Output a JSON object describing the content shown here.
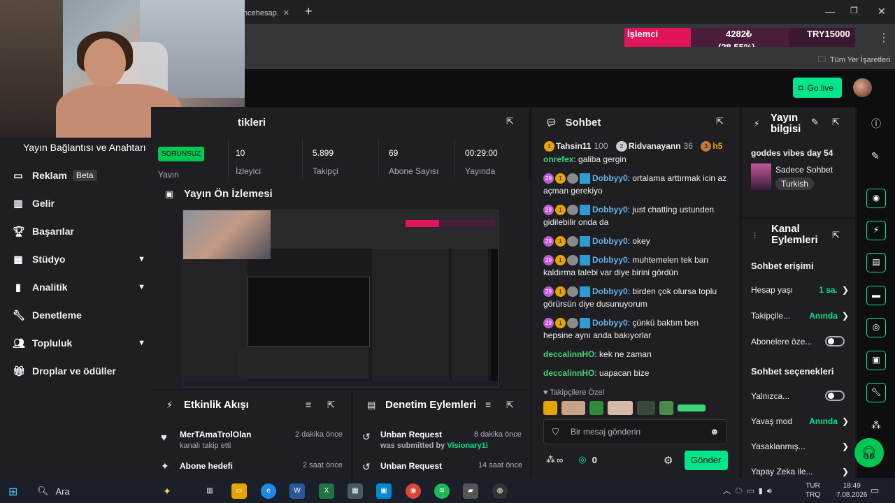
{
  "browser": {
    "tab_label": "ncehesap.",
    "bookmarks_all": "Tüm Yer İşaretleri"
  },
  "perf_overlay": {
    "label": "İşlemci",
    "value": "4282₺",
    "percent": "(28.55%)",
    "target": "TRY15000"
  },
  "topbar": {
    "go_live": "Go live"
  },
  "nav": {
    "title": "Yayın Bağlantısı ve Anahtarı",
    "items": [
      {
        "icon": "ads-icon",
        "label": "Reklam",
        "badge": "Beta"
      },
      {
        "icon": "income-icon",
        "label": "Gelir"
      },
      {
        "icon": "trophy-icon",
        "label": "Başarılar"
      },
      {
        "icon": "studio-icon",
        "label": "Stüdyo"
      },
      {
        "icon": "analytics-icon",
        "label": "Analitik"
      },
      {
        "icon": "wrench-icon",
        "label": "Denetleme"
      },
      {
        "icon": "community-icon",
        "label": "Topluluk"
      },
      {
        "icon": "drops-icon",
        "label": "Droplar ve ödüller"
      }
    ]
  },
  "stats": {
    "title": "tikleri",
    "status_badge": "SORUNSUZ",
    "status_label": "Yayın",
    "cols": [
      {
        "value": "10",
        "label": "İzleyici"
      },
      {
        "value": "5.899",
        "label": "Takipçi"
      },
      {
        "value": "69",
        "label": "Abone Sayısı"
      },
      {
        "value": "00:29:00",
        "label": "Yayında"
      }
    ]
  },
  "preview": {
    "title": "Yayın Ön İzlemesi"
  },
  "activity": {
    "title": "Etkinlik Akışı",
    "items": [
      {
        "name": "MerTAmaTrolOlan",
        "sub": "kanalı takip etti",
        "time": "2 dakika önce"
      },
      {
        "name": "Abone hedefi",
        "sub": "",
        "time": "2 saat önce"
      }
    ]
  },
  "moderation": {
    "title": "Denetim Eylemleri",
    "items": [
      {
        "name": "Unban Request",
        "sub_prefix": "was submitted by ",
        "sub_user": "Visionary1i",
        "time": "8 dakika önce"
      },
      {
        "name": "Unban Request",
        "time": "14 saat önce"
      }
    ]
  },
  "chat": {
    "title": "Sohbet",
    "leaders": [
      {
        "name": "Tahsin11",
        "count": "100"
      },
      {
        "name": "Ridvanayann",
        "count": "36"
      },
      {
        "name": "h5"
      }
    ],
    "messages": [
      {
        "user": "onrefex",
        "text": "galiba gergin"
      },
      {
        "user": "Dobbyy0",
        "text": "ortalama arttırmak icin az açman gerekiyo"
      },
      {
        "user": "Dobbyy0",
        "text": "just chatting ustunden gidilebilir onda da"
      },
      {
        "user": "Dobbyy0",
        "text": "okey"
      },
      {
        "user": "Dobbyy0",
        "text": "muhtemelen tek ban kaldırma talebi var diye birini gördün"
      },
      {
        "user": "Dobbyy0",
        "text": "birden çok olursa toplu görürsün diye dusunuyorum"
      },
      {
        "user": "Dobbyy0",
        "text": "çünkü baktım ben hepsine aynı anda bakıyorlar"
      },
      {
        "user": "deccalinnHO",
        "text": "kek ne zaman"
      },
      {
        "user": "deccalinnHO",
        "text": "uapacan bize"
      }
    ],
    "badge_sub": "29",
    "badge_bits": "1",
    "followers_only": "Takipçilere Özel",
    "input_placeholder": "Bir mesaj gönderin",
    "infinity": "∞",
    "points": "0",
    "send": "Gönder"
  },
  "stream_info": {
    "title": "Yayın bilgisi",
    "stream_title": "goddes vibes day 54",
    "category": "Sadece Sohbet",
    "tag": "Turkish"
  },
  "channel_actions": {
    "title": "Kanal Eylemleri",
    "chat_access": "Sohbet erişimi",
    "rows1": [
      {
        "label": "Hesap yaşı",
        "value": "1 sa.",
        "type": "link"
      },
      {
        "label": "Takipçile...",
        "value": "Anında",
        "type": "link"
      },
      {
        "label": "Abonelere öze...",
        "value": "",
        "type": "toggle"
      }
    ],
    "chat_options": "Sohbet seçenekleri",
    "rows2": [
      {
        "label": "Yalnızca...",
        "value": "",
        "type": "toggle"
      },
      {
        "label": "Yavaş mod",
        "value": "Anında",
        "type": "link"
      },
      {
        "label": "Yasaklanmış...",
        "value": "",
        "type": "link"
      },
      {
        "label": "Yapay Zeka ile...",
        "value": "",
        "type": "link"
      }
    ]
  },
  "taskbar": {
    "search": "Ara",
    "lang1": "TUR",
    "lang2": "TRQ",
    "time": "18:49",
    "date": "7.08.2026"
  },
  "colors": {
    "accent": "#00e68a",
    "sub_badge": "#bf5ad6",
    "username_blue": "#6ab0e8",
    "username_green": "#3ed67a"
  }
}
